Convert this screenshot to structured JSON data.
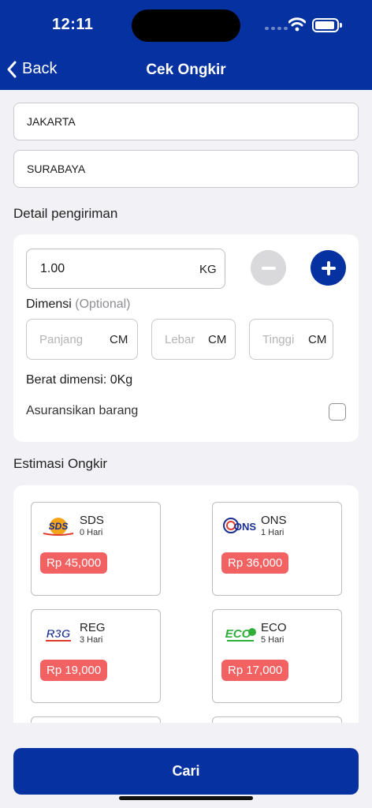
{
  "status_bar": {
    "time": "12:11"
  },
  "nav": {
    "back_label": "Back",
    "title": "Cek Ongkir"
  },
  "route": {
    "origin": "JAKARTA",
    "destination": "SURABAYA"
  },
  "detail": {
    "section_title": "Detail pengiriman",
    "weight_value": "1.00",
    "weight_unit": "KG",
    "dimension_label": "Dimensi",
    "dimension_optional": "(Optional)",
    "length_placeholder": "Panjang",
    "width_placeholder": "Lebar",
    "height_placeholder": "Tinggi",
    "dimension_unit": "CM",
    "dimension_weight": "Berat dimensi: 0Kg",
    "insurance_label": "Asuransikan barang"
  },
  "estimate": {
    "section_title": "Estimasi Ongkir",
    "services": [
      {
        "name": "SDS",
        "days": "0 Hari",
        "price": "Rp 45,000",
        "logo_text": "SDS"
      },
      {
        "name": "ONS",
        "days": "1 Hari",
        "price": "Rp 36,000",
        "logo_text": "ONS"
      },
      {
        "name": "REG",
        "days": "3 Hari",
        "price": "Rp 19,000",
        "logo_text": "R3G"
      },
      {
        "name": "ECO",
        "days": "5 Hari",
        "price": "Rp 17,000",
        "logo_text": "ECO"
      }
    ]
  },
  "submit_label": "Cari",
  "colors": {
    "primary": "#0532a0",
    "price_badge": "#f36262",
    "background": "#f2f2f6"
  }
}
